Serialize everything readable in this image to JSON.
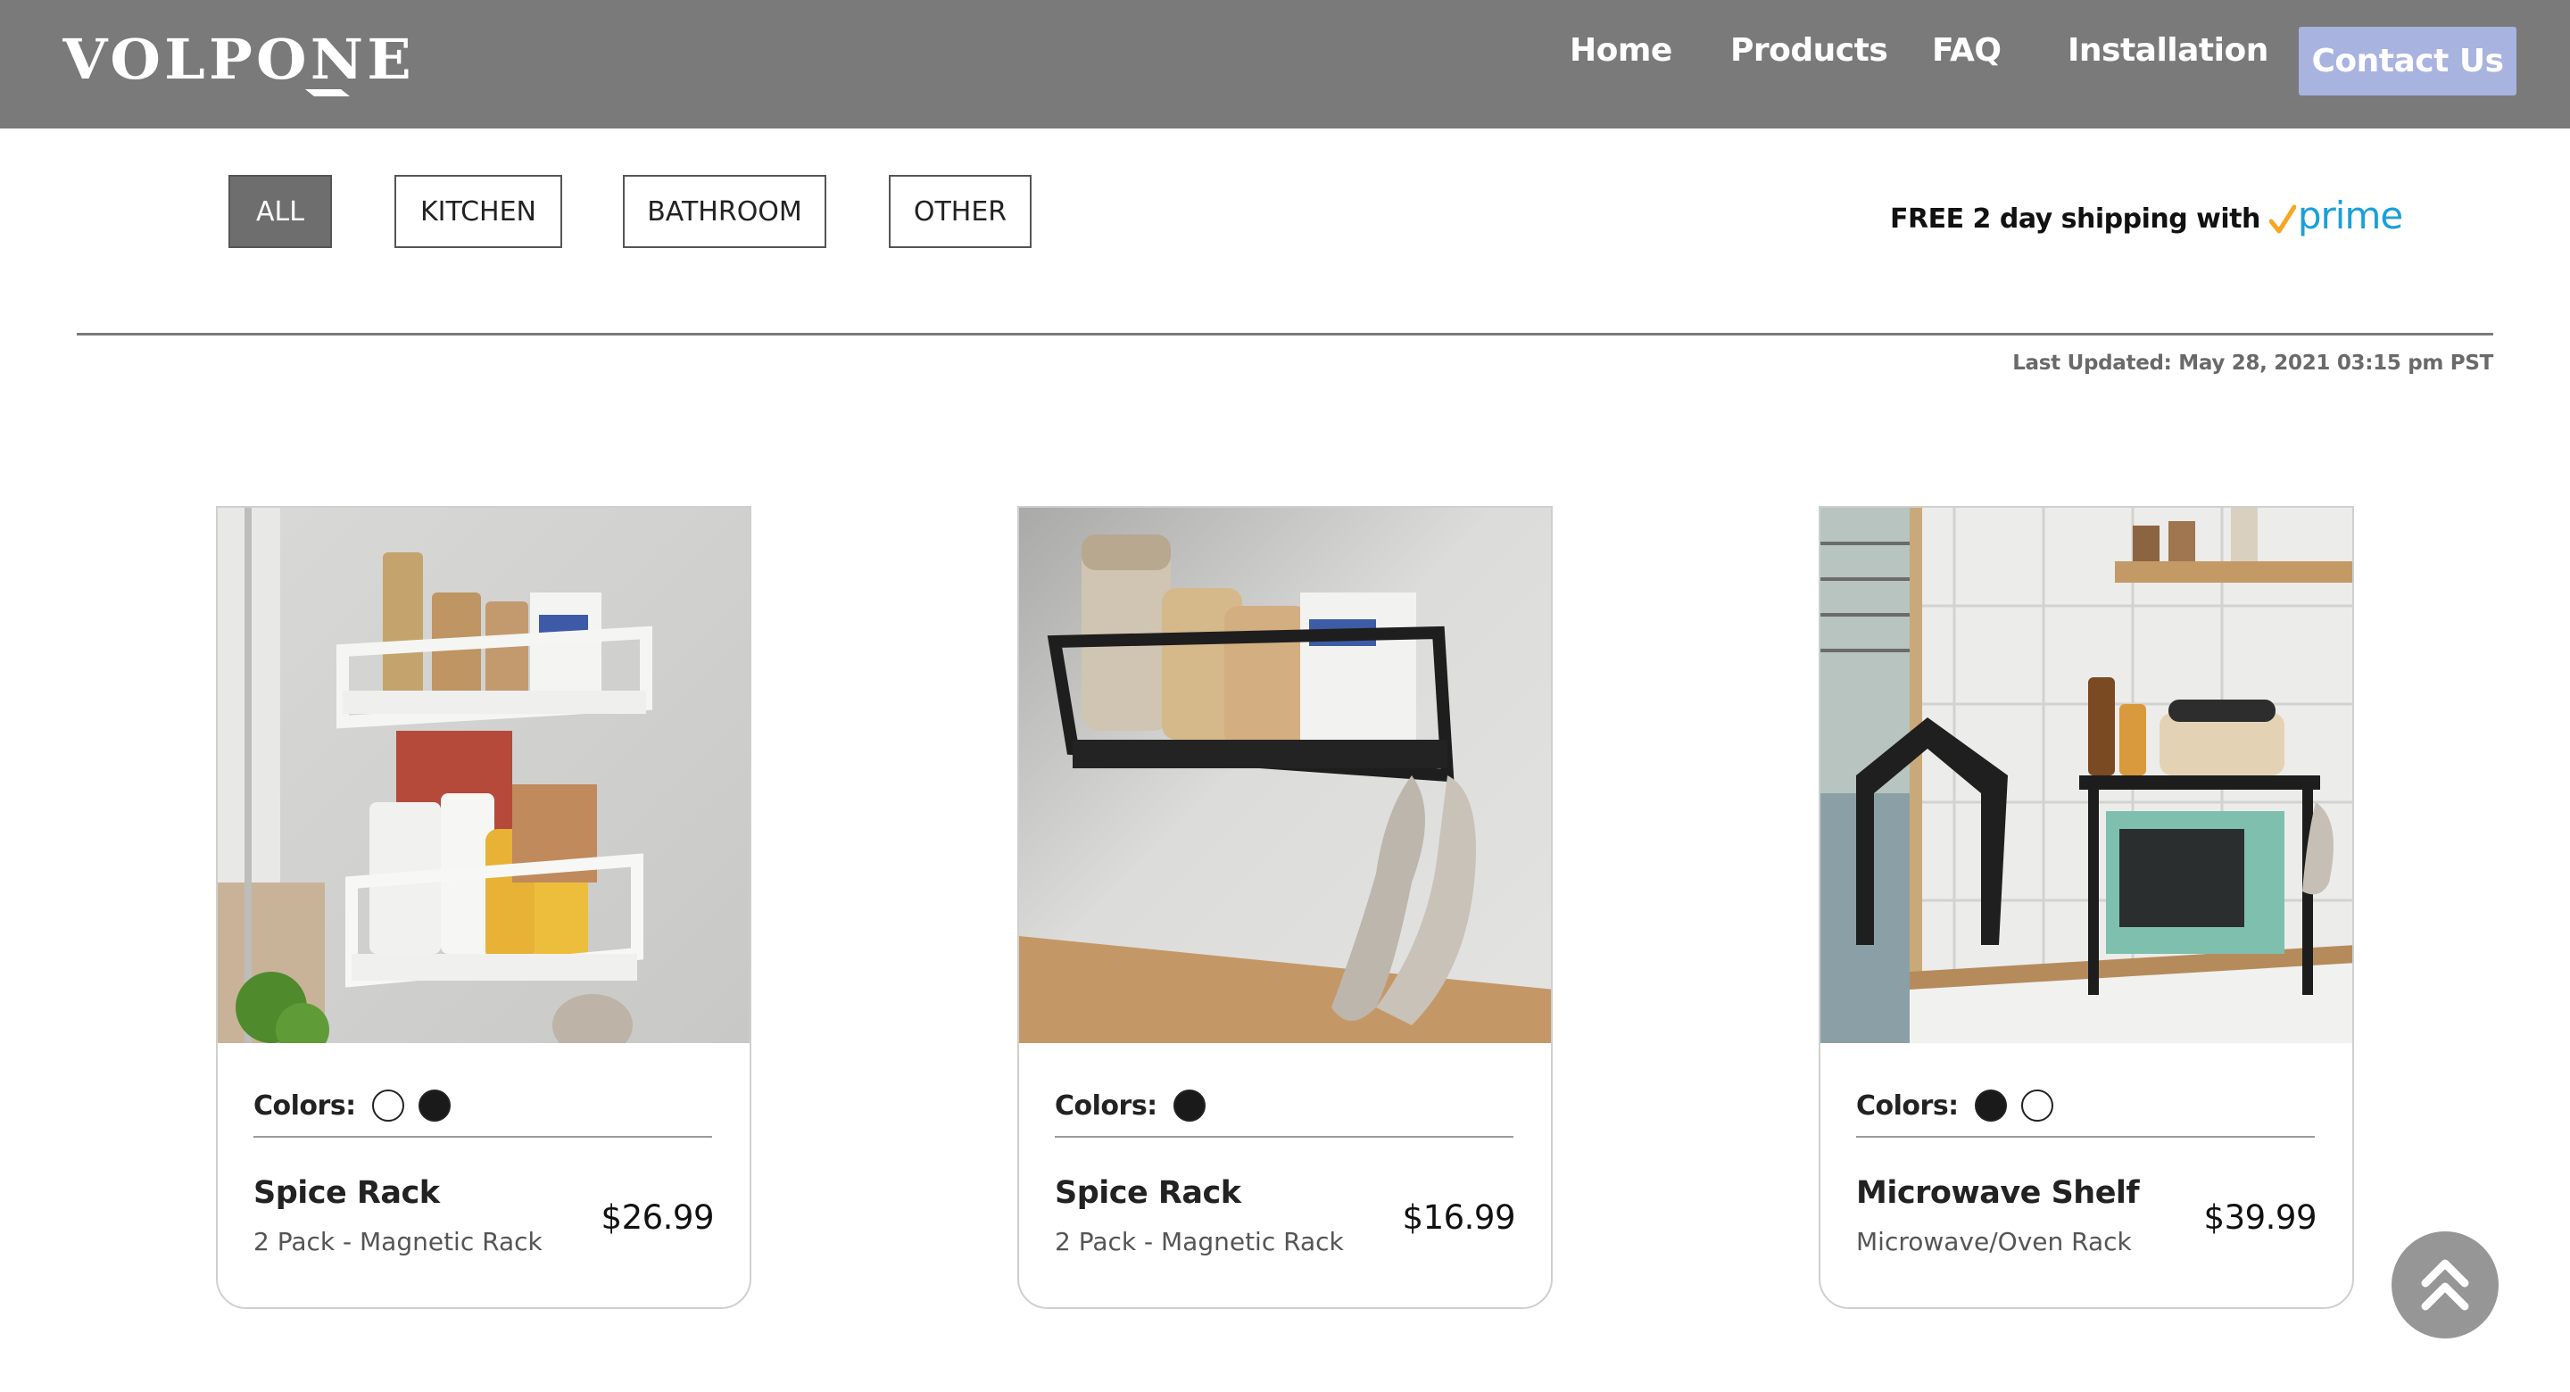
{
  "header": {
    "logo_text": "VOLPONE",
    "nav": [
      {
        "label": "Home"
      },
      {
        "label": "Products"
      },
      {
        "label": "FAQ"
      },
      {
        "label": "Installation"
      }
    ],
    "contact_label": "Contact Us",
    "colors": {
      "bar": "#7a7a7a",
      "contact_bg": "#a9b3e0"
    }
  },
  "filters": [
    {
      "label": "ALL",
      "active": true
    },
    {
      "label": "KITCHEN",
      "active": false
    },
    {
      "label": "BATHROOM",
      "active": false
    },
    {
      "label": "OTHER",
      "active": false
    }
  ],
  "shipping": {
    "text": "FREE 2 day shipping with",
    "prime_label": "prime",
    "prime_color": "#1aa0d8",
    "check_color": "#f5a623"
  },
  "last_updated": "Last Updated: May 28, 2021 03:15 pm PST",
  "products": [
    {
      "image": "white-double-spice-rack-photo",
      "colors_label": "Colors:",
      "swatches": [
        "white",
        "black"
      ],
      "name": "Spice Rack",
      "subtitle": "2 Pack - Magnetic Rack",
      "price": "$26.99"
    },
    {
      "image": "black-spice-rack-photo",
      "colors_label": "Colors:",
      "swatches": [
        "black"
      ],
      "name": "Spice Rack",
      "subtitle": "2 Pack - Magnetic Rack",
      "price": "$16.99"
    },
    {
      "image": "microwave-shelf-photo",
      "colors_label": "Colors:",
      "swatches": [
        "black",
        "white"
      ],
      "name": "Microwave Shelf",
      "subtitle": "Microwave/Oven Rack",
      "price": "$39.99"
    }
  ],
  "scroll_top_icon": "double-chevron-up-icon"
}
